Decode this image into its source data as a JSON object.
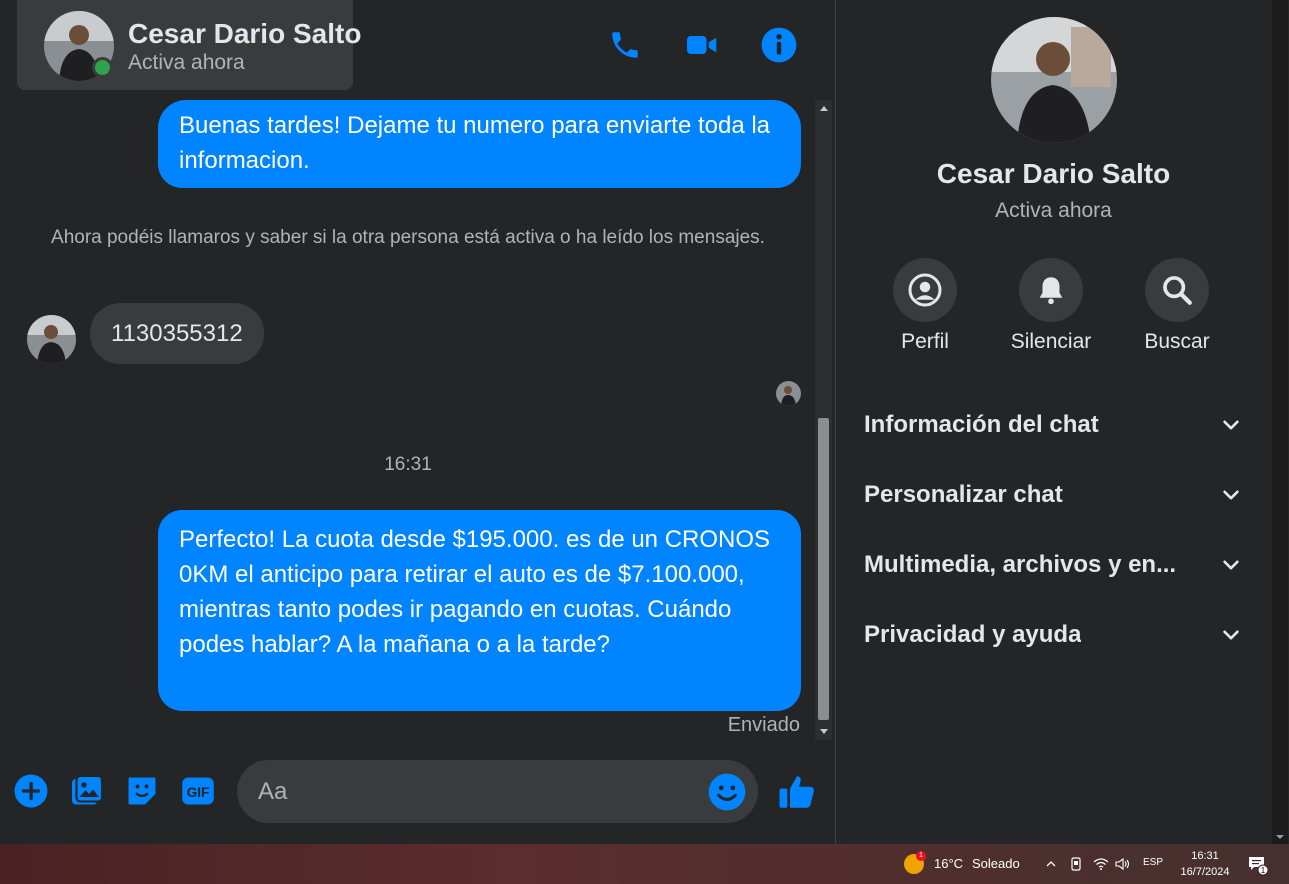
{
  "contact": {
    "name": "Cesar Dario Salto",
    "status": "Activa ahora"
  },
  "messages": {
    "outgoing_1": "Buenas tardes! Dejame tu numero para enviarte toda la informacion.",
    "system_note": "Ahora podéis llamaros y saber si la otra persona está activa o ha leído los mensajes.",
    "incoming_1": "1130355312",
    "time_separator": "16:31",
    "outgoing_2": "Perfecto! La cuota desde $195.000. es de un CRONOS 0KM el anticipo para retirar el auto es de $7.100.000, mientras tanto podes ir pagando en cuotas. Cuándo podes hablar? A la mañana o a la tarde?",
    "sent_status": "Enviado"
  },
  "composer": {
    "placeholder": "Aa"
  },
  "info_panel": {
    "actions": [
      {
        "label": "Perfil",
        "icon": "profile-icon"
      },
      {
        "label": "Silenciar",
        "icon": "bell-icon"
      },
      {
        "label": "Buscar",
        "icon": "search-icon"
      }
    ],
    "sections": [
      {
        "label": "Información del chat"
      },
      {
        "label": "Personalizar chat"
      },
      {
        "label": "Multimedia, archivos y en..."
      },
      {
        "label": "Privacidad y ayuda"
      }
    ]
  },
  "taskbar": {
    "weather_temp": "16°C",
    "weather_condition": "Soleado",
    "weather_badge": "1",
    "language": "ESP",
    "time": "16:31",
    "date": "16/7/2024",
    "notification_count": "1"
  },
  "colors": {
    "accent": "#0084ff",
    "background": "#242526",
    "surface": "#3a3b3c",
    "online": "#31a24c"
  }
}
